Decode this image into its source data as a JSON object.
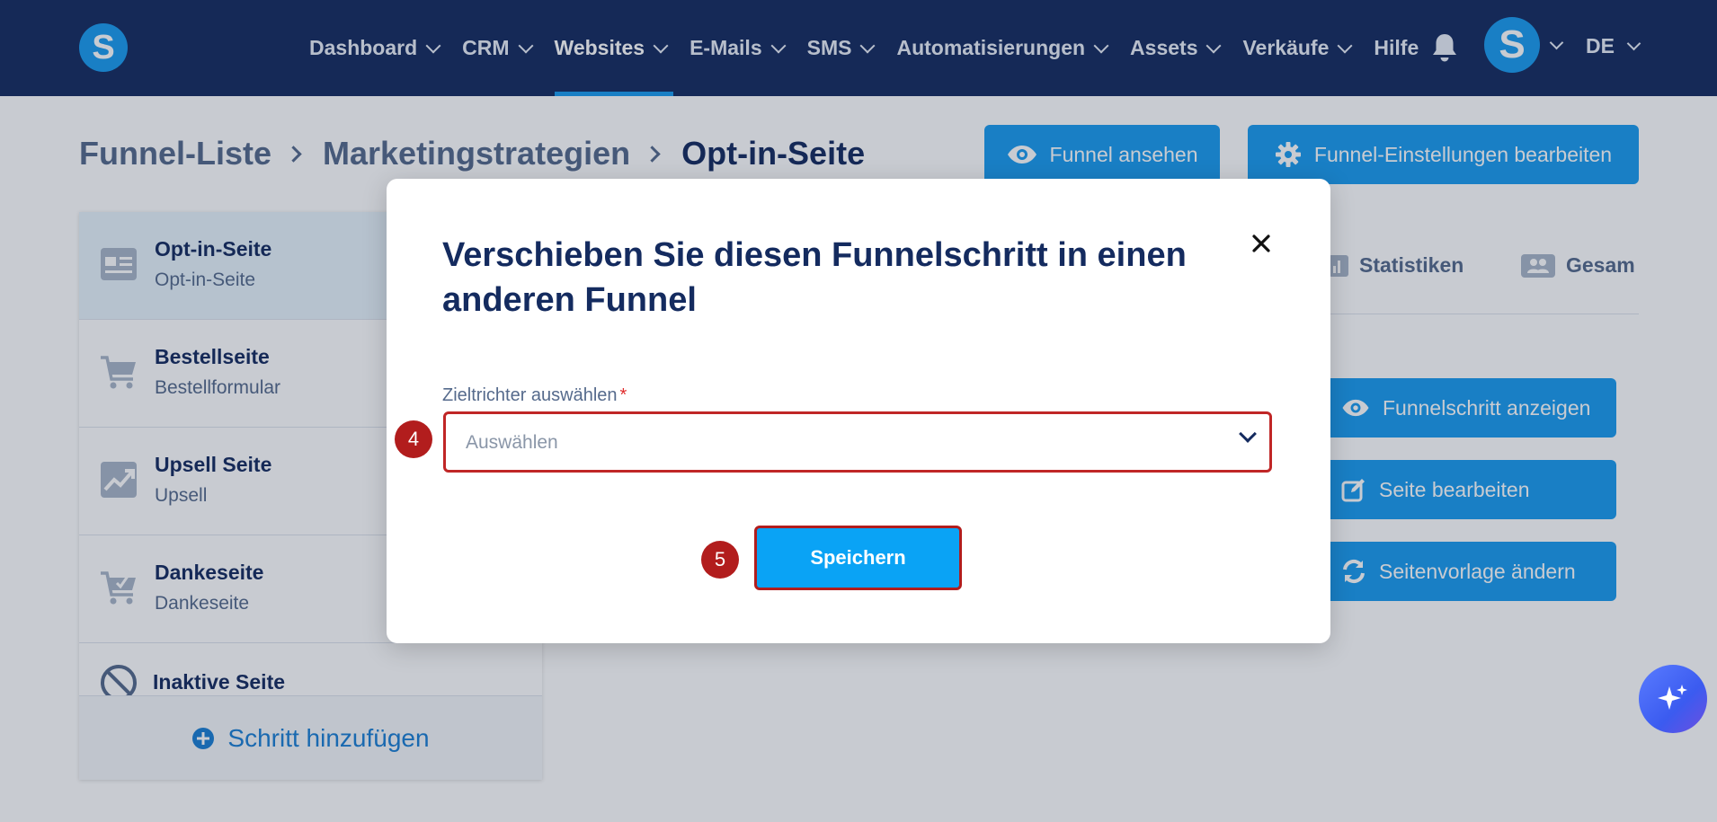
{
  "topnav": {
    "logo_letter": "S",
    "menu": [
      {
        "label": "Dashboard"
      },
      {
        "label": "CRM"
      },
      {
        "label": "Websites"
      },
      {
        "label": "E-Mails"
      },
      {
        "label": "SMS"
      },
      {
        "label": "Automatisierungen"
      },
      {
        "label": "Assets"
      },
      {
        "label": "Verkäufe"
      },
      {
        "label": "Hilfe"
      }
    ],
    "active_item": "Websites",
    "avatar_letter": "S",
    "language": "DE"
  },
  "breadcrumb": {
    "items": [
      "Funnel-Liste",
      "Marketingstrategien",
      "Opt-in-Seite"
    ]
  },
  "header_buttons": {
    "view_funnel": "Funnel ansehen",
    "edit_settings": "Funnel-Einstellungen bearbeiten"
  },
  "steps": [
    {
      "name": "Opt-in-Seite",
      "sub": "Opt-in-Seite",
      "icon": "page-icon"
    },
    {
      "name": "Bestellseite",
      "sub": "Bestellformular",
      "icon": "cart-icon"
    },
    {
      "name": "Upsell Seite",
      "sub": "Upsell",
      "icon": "chart-up-icon"
    },
    {
      "name": "Dankeseite",
      "sub": "Dankeseite",
      "icon": "cart-check-icon"
    },
    {
      "name": "Inaktive Seite",
      "icon": "disabled-icon"
    }
  ],
  "add_step_label": "Schritt hinzufügen",
  "right_panel": {
    "tabs": [
      {
        "label": "Statistiken",
        "icon": "bar-chart-icon"
      },
      {
        "label": "Gesam",
        "icon": "users-icon"
      }
    ],
    "actions": [
      {
        "label": "Funnelschritt anzeigen",
        "icon": "eye-icon"
      },
      {
        "label": "Seite bearbeiten",
        "icon": "edit-icon"
      },
      {
        "label": "Seitenvorlage ändern",
        "icon": "refresh-icon"
      }
    ]
  },
  "modal": {
    "title": "Verschieben Sie diesen Funnelschritt in einen anderen Funnel",
    "field_label": "Zieltrichter auswählen",
    "required_mark": "*",
    "select_placeholder": "Auswählen",
    "save_label": "Speichern",
    "step_badges": [
      "4",
      "5"
    ]
  },
  "colors": {
    "nav_bg": "#142b5f",
    "accent": "#1a9cf0",
    "highlight_border": "#b21d1d",
    "save_button": "#0aa3f5"
  }
}
